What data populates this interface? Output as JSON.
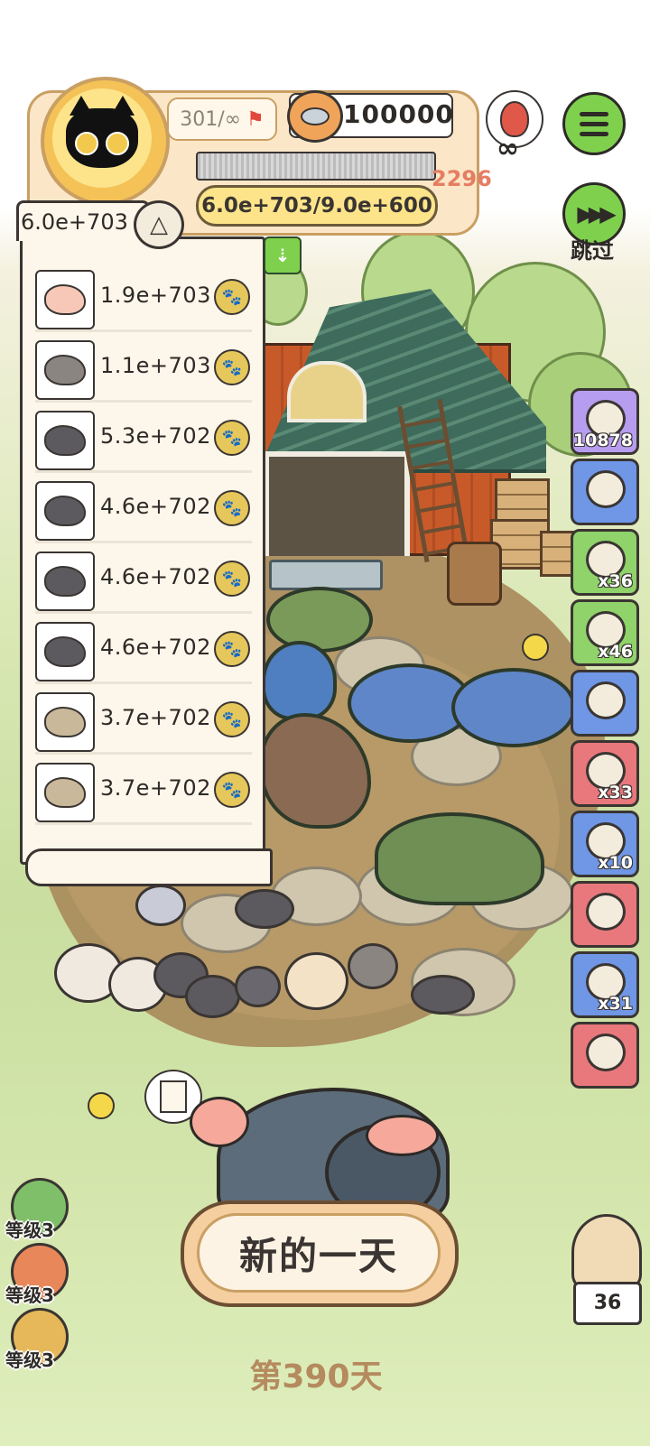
{
  "hud": {
    "level": "301/∞",
    "coins": "100000",
    "xp_cap": "2296",
    "power": "6.0e+703/9.0e+600",
    "infinity_symbol": "∞",
    "skip_label": "跳过"
  },
  "ranking": {
    "total": "6.0e+703",
    "rows": [
      {
        "value": "1.9e+703",
        "icon": "donut-icon",
        "color": "#f7c7b8"
      },
      {
        "value": "1.1e+703",
        "icon": "jerboa-icon",
        "color": "#8a8580"
      },
      {
        "value": "5.3e+702",
        "icon": "mole-icon",
        "color": "#5c5a5f"
      },
      {
        "value": "4.6e+702",
        "icon": "mole-icon",
        "color": "#5c5a5f"
      },
      {
        "value": "4.6e+702",
        "icon": "mole-icon",
        "color": "#5c5a5f"
      },
      {
        "value": "4.6e+702",
        "icon": "mole-icon",
        "color": "#5c5a5f"
      },
      {
        "value": "3.7e+702",
        "icon": "hedgehog-icon",
        "color": "#c9b89a"
      },
      {
        "value": "3.7e+702",
        "icon": "hedgehog-icon",
        "color": "#c9b89a"
      }
    ]
  },
  "side_items": [
    {
      "icon": "rock-donut-icon",
      "count": "10878",
      "bg": "#b79df0"
    },
    {
      "icon": "jar-icon",
      "count": "",
      "bg": "#6f97e6"
    },
    {
      "icon": "tent-icon",
      "count": "x36",
      "bg": "#8fd36a"
    },
    {
      "icon": "worm-icon",
      "count": "x46",
      "bg": "#8fd36a"
    },
    {
      "icon": "hat-icon",
      "count": "",
      "bg": "#6f97e6"
    },
    {
      "icon": "bag-icon",
      "count": "x33",
      "bg": "#e8787c"
    },
    {
      "icon": "donut-icon",
      "count": "x10",
      "bg": "#6f97e6"
    },
    {
      "icon": "rope-icon",
      "count": "",
      "bg": "#e8787c"
    },
    {
      "icon": "bread-icon",
      "count": "x31",
      "bg": "#6f97e6"
    },
    {
      "icon": "gift-icon",
      "count": "",
      "bg": "#e8787c"
    }
  ],
  "level_badges": [
    {
      "label": "等级3",
      "color": "#7fbf6a"
    },
    {
      "label": "等级3",
      "color": "#e8875a"
    },
    {
      "label": "等级3",
      "color": "#e6b85a"
    }
  ],
  "new_day_label": "新的一天",
  "day_label": "第390天",
  "owl_count": "36"
}
